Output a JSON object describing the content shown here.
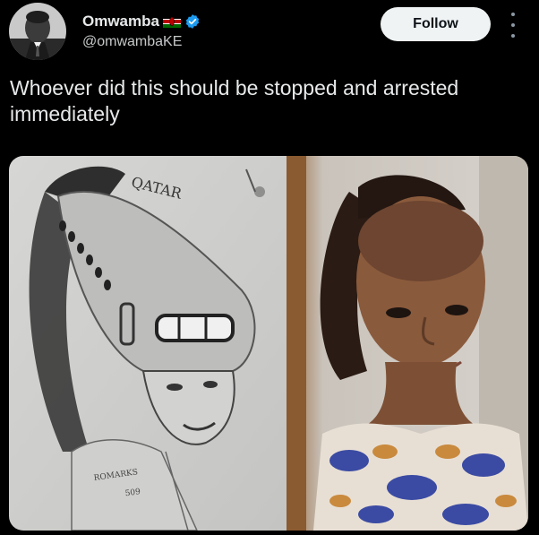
{
  "author": {
    "display_name": "Omwamba",
    "handle": "@omwambaKE",
    "flag": "kenya-flag",
    "verified": true,
    "avatar": "profile-photo"
  },
  "actions": {
    "follow_label": "Follow",
    "more_icon": "more-options-icon"
  },
  "tweet": {
    "text": "Whoever did this should be stopped and arrested immediately"
  },
  "media": {
    "left_image": {
      "description": "pencil-sketch",
      "text_top": "QATAR",
      "signature_line1": "ROMARKS",
      "signature_line2": "509"
    },
    "right_image": {
      "description": "photo"
    }
  },
  "colors": {
    "background": "#000000",
    "text": "#e7e9ea",
    "button_bg": "#eff3f4",
    "verified": "#1d9bf0"
  }
}
